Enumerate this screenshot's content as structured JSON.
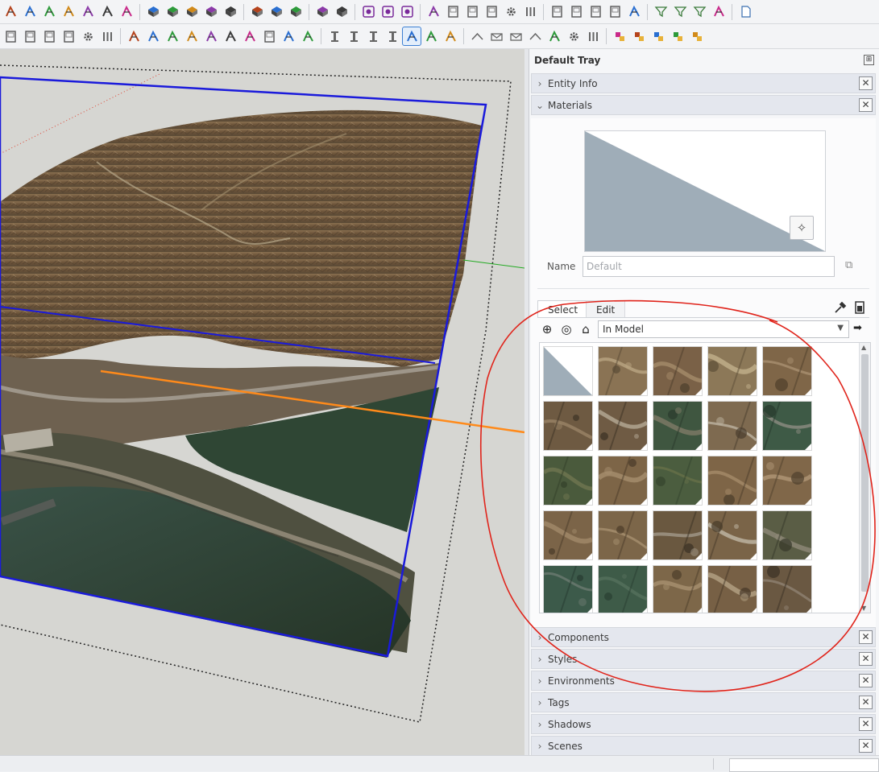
{
  "toolbar_row1": [
    "select-icon",
    "push-pull-icon",
    "move-icon",
    "offset-icon",
    "rotate-icon",
    "scale-icon",
    "follow-me-icon",
    "sep",
    "solid-union-icon",
    "solid-subtract-icon",
    "solid-intersect-icon",
    "solid-trim-icon",
    "solid-split-icon",
    "sep",
    "sandbox-box-icon",
    "sandbox-cube-icon",
    "sandbox-grid-icon",
    "sep",
    "terrain-icon",
    "terrain-stamp-icon",
    "sep",
    "section-plane-icon",
    "section-cut-icon",
    "section-fill-icon",
    "sep",
    "align-icon",
    "frame-icon",
    "box-icon",
    "rect-icon",
    "gear-icon",
    "bars-icon",
    "sep",
    "panel-icon",
    "panel2-icon",
    "panel3-icon",
    "panel4-icon",
    "corner-icon",
    "sep",
    "filter-icon",
    "filter2-icon",
    "filter3-icon",
    "brush-icon",
    "sep",
    "new-doc-icon"
  ],
  "toolbar_row2": [
    "door-icon",
    "window-icon",
    "frame-icon",
    "wall-icon",
    "gear-icon",
    "bars-icon",
    "sep",
    "move-left-icon",
    "move-right-icon",
    "resize-icon",
    "corner-icon",
    "stretch-icon",
    "grow-icon",
    "split-icon",
    "panel-icon",
    "cross-icon",
    "width-icon",
    "sep",
    "column-icon",
    "beam-icon",
    "truss-icon",
    "joist-icon",
    "cut-icon",
    "stair-icon",
    "rail-icon",
    "sep",
    "roof-icon",
    "envelope-icon",
    "mail-icon",
    "chevron-icon",
    "fence-icon",
    "gear-icon",
    "bars-icon",
    "sep",
    "explode-icon",
    "group-icon",
    "nest-icon",
    "component-icon",
    "swap-icon"
  ],
  "tray": {
    "title": "Default Tray",
    "panels": {
      "entity_info": "Entity Info",
      "materials": "Materials",
      "components": "Components",
      "styles": "Styles",
      "environments": "Environments",
      "tags": "Tags",
      "shadows": "Shadows",
      "scenes": "Scenes"
    },
    "close_glyph": "✕",
    "materials": {
      "name_label": "Name",
      "name_placeholder": "Default",
      "tab_select": "Select",
      "tab_edit": "Edit",
      "library": "In Model",
      "swatches": [
        {
          "kind": "default"
        },
        {
          "kind": "img",
          "c1": "#8a7354",
          "c2": "#b9a582",
          "c3": "#5a4b36"
        },
        {
          "kind": "img",
          "c1": "#7a6147",
          "c2": "#a58c6a",
          "c3": "#4d3e2c"
        },
        {
          "kind": "img",
          "c1": "#8c7858",
          "c2": "#c2b08c",
          "c3": "#5d4e37"
        },
        {
          "kind": "img",
          "c1": "#7f6648",
          "c2": "#a99070",
          "c3": "#4e3f2b"
        },
        {
          "kind": "img",
          "c1": "#6e5a42",
          "c2": "#9a8366",
          "c3": "#3d3326"
        },
        {
          "kind": "img",
          "c1": "#6f5b44",
          "c2": "#b5aa96",
          "c3": "#3a3024"
        },
        {
          "kind": "img",
          "c1": "#3f5640",
          "c2": "#7f7a66",
          "c3": "#2b3a2c"
        },
        {
          "kind": "img",
          "c1": "#7e6a50",
          "c2": "#bdb3a0",
          "c3": "#4a3d2e"
        },
        {
          "kind": "img",
          "c1": "#3e5a46",
          "c2": "#8d8c82",
          "c3": "#26372b"
        },
        {
          "kind": "img",
          "c1": "#4a5a3c",
          "c2": "#6f7550",
          "c3": "#33402a"
        },
        {
          "kind": "img",
          "c1": "#7d6547",
          "c2": "#a68e6e",
          "c3": "#4a3b29"
        },
        {
          "kind": "img",
          "c1": "#4b5d3f",
          "c2": "#667049",
          "c3": "#34452e"
        },
        {
          "kind": "img",
          "c1": "#7e6547",
          "c2": "#a58b69",
          "c3": "#4c3d2b"
        },
        {
          "kind": "img",
          "c1": "#806749",
          "c2": "#b09777",
          "c3": "#4f402d"
        },
        {
          "kind": "img",
          "c1": "#7b6448",
          "c2": "#a28a6a",
          "c3": "#4a3b2a"
        },
        {
          "kind": "img",
          "c1": "#7c6649",
          "c2": "#a6906f",
          "c3": "#4b3c2a"
        },
        {
          "kind": "img",
          "c1": "#6a5840",
          "c2": "#a19888",
          "c3": "#3a3124"
        },
        {
          "kind": "img",
          "c1": "#7a6448",
          "c2": "#c1b8a6",
          "c3": "#473a2a"
        },
        {
          "kind": "img",
          "c1": "#5a5d45",
          "c2": "#8f8a78",
          "c3": "#36382a"
        },
        {
          "kind": "img",
          "c1": "#3c5a4a",
          "c2": "#6b7a70",
          "c3": "#263a30"
        },
        {
          "kind": "img",
          "c1": "#3e5b48",
          "c2": "#55705c",
          "c3": "#2a3f32"
        },
        {
          "kind": "img",
          "c1": "#7d6749",
          "c2": "#a79170",
          "c3": "#4d3e2b"
        },
        {
          "kind": "img",
          "c1": "#776045",
          "c2": "#b4a284",
          "c3": "#463828"
        },
        {
          "kind": "img",
          "c1": "#6a5842",
          "c2": "#8f8272",
          "c3": "#3b3125"
        }
      ]
    }
  },
  "colors": {
    "annotation_red": "#e0241b",
    "axis_blue": "#1a1adb",
    "axis_green": "#22aa22",
    "axis_orange": "#ff8a1a",
    "water": "#34463a"
  }
}
